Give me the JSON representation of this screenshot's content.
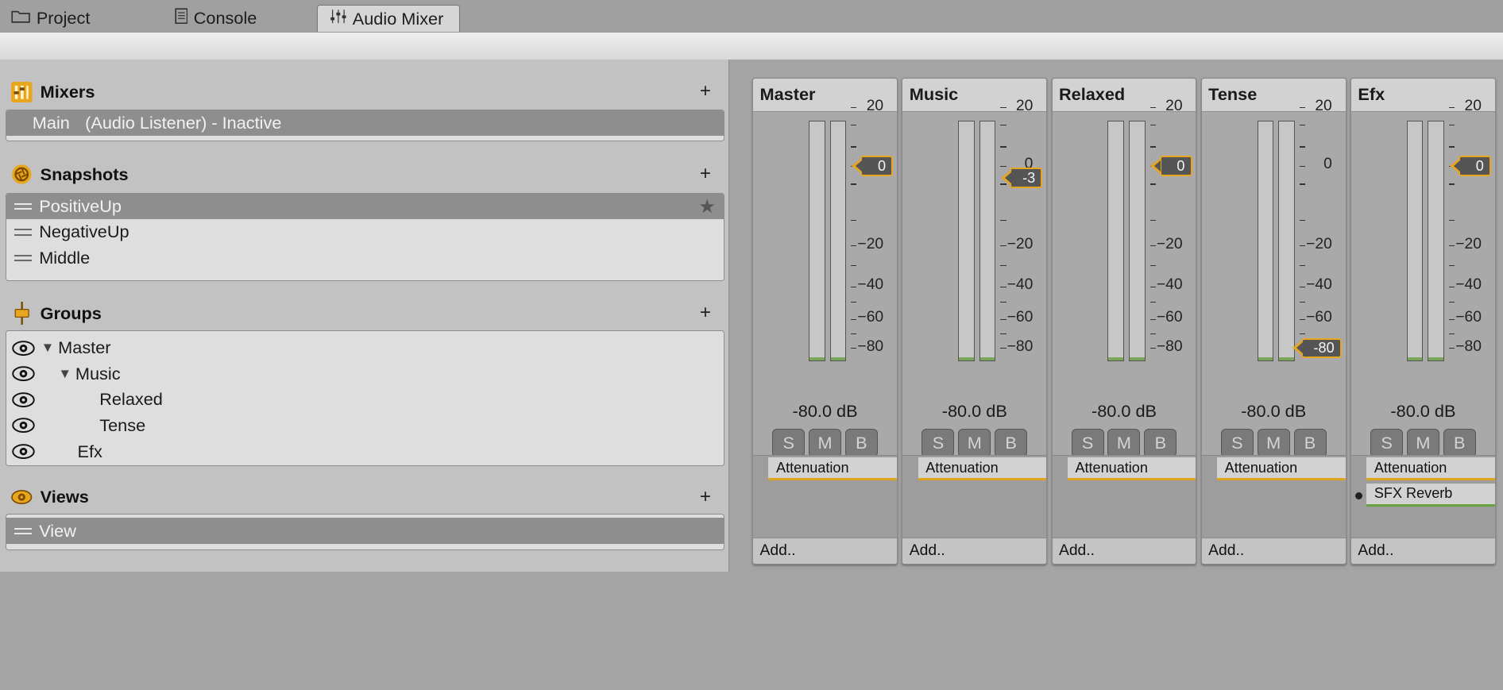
{
  "tabs": [
    {
      "label": "Project",
      "icon": "folder-icon"
    },
    {
      "label": "Console",
      "icon": "console-icon"
    },
    {
      "label": "Audio Mixer",
      "icon": "mixer-icon",
      "active": true
    }
  ],
  "sections": {
    "mixers": {
      "title": "Mixers",
      "add_label": "+",
      "items": [
        {
          "name": "Main",
          "detail": "(Audio Listener) - Inactive",
          "selected": true
        }
      ]
    },
    "snapshots": {
      "title": "Snapshots",
      "add_label": "+",
      "items": [
        {
          "name": "PositiveUp",
          "selected": true,
          "starred": true
        },
        {
          "name": "NegativeUp"
        },
        {
          "name": "Middle"
        }
      ]
    },
    "groups": {
      "title": "Groups",
      "add_label": "+",
      "items": [
        {
          "name": "Master",
          "expanded": true
        },
        {
          "name": "Music",
          "expanded": true
        },
        {
          "name": "Relaxed"
        },
        {
          "name": "Tense"
        },
        {
          "name": "Efx"
        }
      ]
    },
    "views": {
      "title": "Views",
      "add_label": "+",
      "items": [
        {
          "name": "View",
          "selected": true
        }
      ]
    }
  },
  "scale_labels": [
    "20",
    "0",
    "−20",
    "−40",
    "−60",
    "−80"
  ],
  "strips": [
    {
      "name": "Master",
      "fader": "0",
      "level": "-80.0 dB",
      "effects": [
        "Attenuation"
      ],
      "add_label": "Add..",
      "buttons": [
        "S",
        "M",
        "B"
      ]
    },
    {
      "name": "Music",
      "fader": "-3",
      "level": "-80.0 dB",
      "effects": [
        "Attenuation"
      ],
      "add_label": "Add..",
      "buttons": [
        "S",
        "M",
        "B"
      ]
    },
    {
      "name": "Relaxed",
      "fader": "0",
      "level": "-80.0 dB",
      "effects": [
        "Attenuation"
      ],
      "add_label": "Add..",
      "buttons": [
        "S",
        "M",
        "B"
      ]
    },
    {
      "name": "Tense",
      "fader": "-80",
      "level": "-80.0 dB",
      "effects": [
        "Attenuation"
      ],
      "add_label": "Add..",
      "buttons": [
        "S",
        "M",
        "B"
      ]
    },
    {
      "name": "Efx",
      "fader": "0",
      "level": "-80.0 dB",
      "effects": [
        "Attenuation",
        "SFX Reverb"
      ],
      "add_label": "Add..",
      "buttons": [
        "S",
        "M",
        "B"
      ]
    }
  ],
  "colors": {
    "accent": "#e8a51e",
    "reverb": "#6aa442",
    "meter_floor": "#7aa55a"
  }
}
